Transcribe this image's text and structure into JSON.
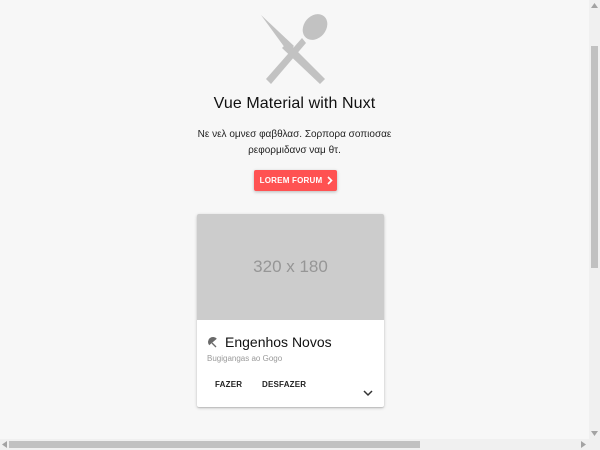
{
  "hero": {
    "icon": "cutlery-icon",
    "title": "Vue Material with Nuxt",
    "subtitle": "Νε νελ ομνεσ φαβθλασ. Σορπορα σοπιοσαε ρεφορμιδανσ ναμ θτ."
  },
  "cta": {
    "label": "LOREM FORUM",
    "icon": "chevron-right-icon",
    "color": "#ff5252"
  },
  "card": {
    "media_placeholder": "320 x 180",
    "icon": "umbrella-icon",
    "title": "Engenhos Novos",
    "subhead": "Bugigangas ao Gogo",
    "actions": [
      "FAZER",
      "DESFAZER"
    ],
    "expand_icon": "chevron-down-icon"
  },
  "colors": {
    "accent": "#ff5252",
    "page_background": "#f7f7f7",
    "placeholder": "#cccccc"
  }
}
